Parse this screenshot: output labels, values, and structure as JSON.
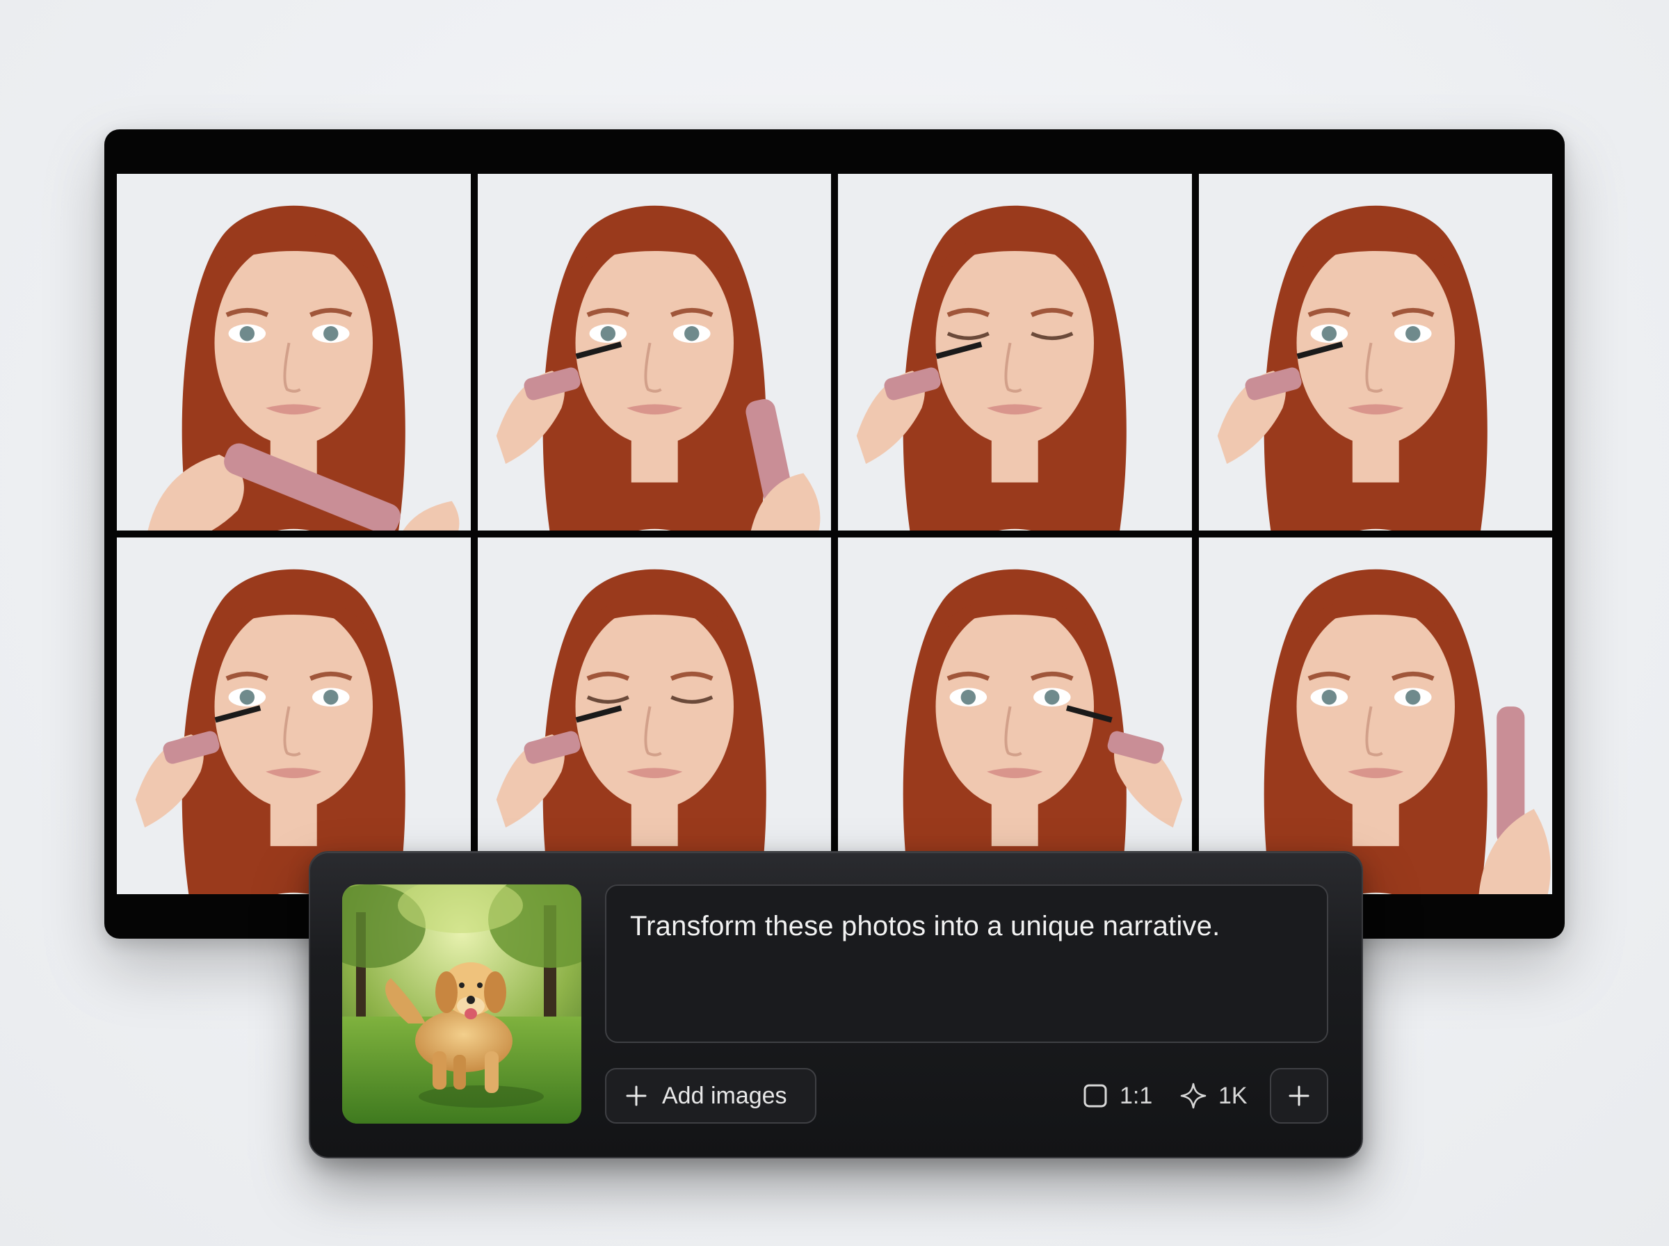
{
  "gallery": {
    "tiles": [
      {
        "alt": "photo-1"
      },
      {
        "alt": "photo-2"
      },
      {
        "alt": "photo-3"
      },
      {
        "alt": "photo-4"
      },
      {
        "alt": "photo-5"
      },
      {
        "alt": "photo-6"
      },
      {
        "alt": "photo-7"
      },
      {
        "alt": "photo-8"
      }
    ]
  },
  "composer": {
    "reference_image": "golden-retriever-photo",
    "prompt_text": "Transform these photos into a unique narrative.",
    "add_images_label": "Add images",
    "aspect_ratio": "1:1",
    "resolution": "1K",
    "icons": {
      "add": "plus-icon",
      "ratio": "square-icon",
      "resolution": "sparkle-icon",
      "more": "plus-icon"
    }
  },
  "colors": {
    "hair": "#9a3a1c",
    "skin": "#f0c8b0",
    "panel": "#1b1c1f",
    "board": "#050505"
  }
}
